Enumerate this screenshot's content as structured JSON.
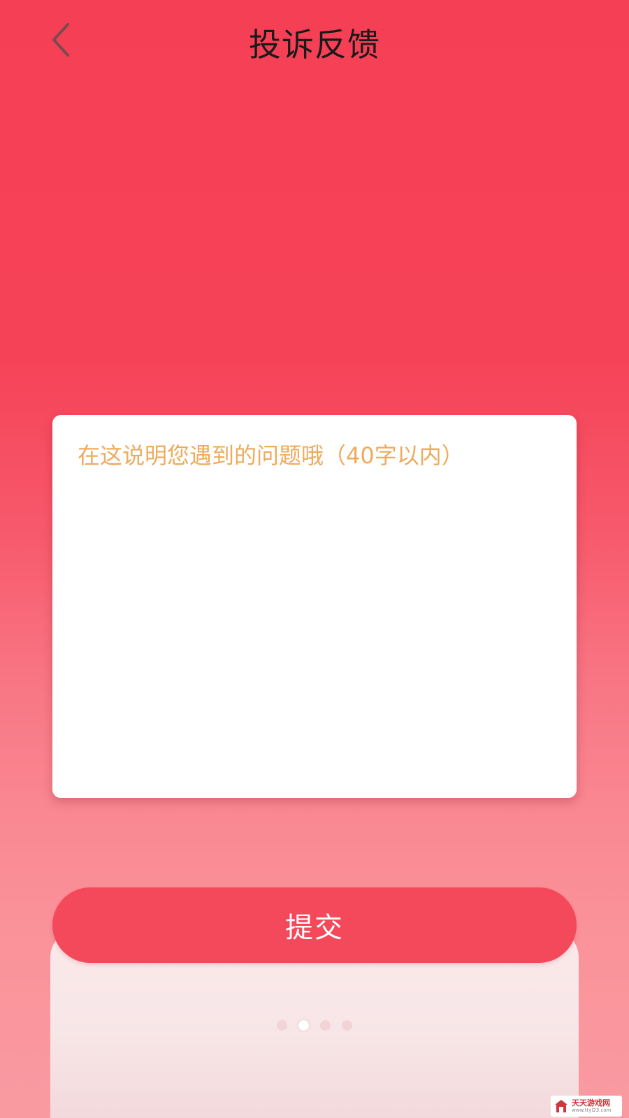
{
  "header": {
    "title": "投诉反馈",
    "back_icon": "chevron-left-icon"
  },
  "feedback": {
    "placeholder": "在这说明您遇到的问题哦（40字以内）",
    "value": ""
  },
  "submit": {
    "label": "提交"
  },
  "carousel": {
    "total": 4,
    "active_index": 1
  },
  "watermark": {
    "name": "天天游戏网",
    "url": "www.ttyl23.com"
  },
  "colors": {
    "background_top": "#f53f55",
    "background_bottom": "#f99aa1",
    "button": "#f4495b",
    "placeholder": "#eeab5c",
    "title": "#1a1a1a"
  }
}
